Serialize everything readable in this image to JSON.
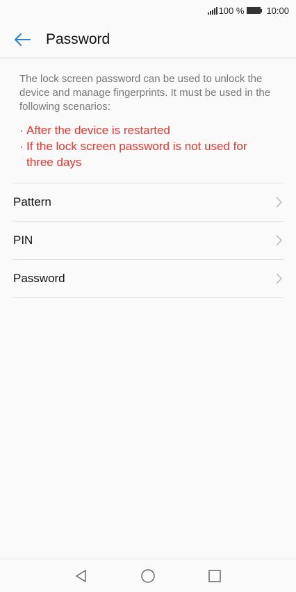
{
  "status_bar": {
    "battery_percent": "100 %",
    "time": "10:00"
  },
  "header": {
    "title": "Password",
    "back_icon": "arrow-left-icon",
    "accent_color": "#2d7fd8"
  },
  "description": "The lock screen password can be used to unlock the device and manage fingerprints. It must be used in the following scenarios:",
  "warnings": [
    {
      "bullet": "·",
      "text": "After the device is restarted"
    },
    {
      "bullet": "·",
      "text": "If the lock screen password is not used for three days"
    }
  ],
  "warning_color": "#e8352e",
  "options": [
    {
      "label": "Pattern",
      "icon": "chevron-right-icon"
    },
    {
      "label": "PIN",
      "icon": "chevron-right-icon"
    },
    {
      "label": "Password",
      "icon": "chevron-right-icon"
    }
  ],
  "nav_bar": {
    "back": "nav-back-icon",
    "home": "nav-home-icon",
    "recents": "nav-recents-icon"
  }
}
